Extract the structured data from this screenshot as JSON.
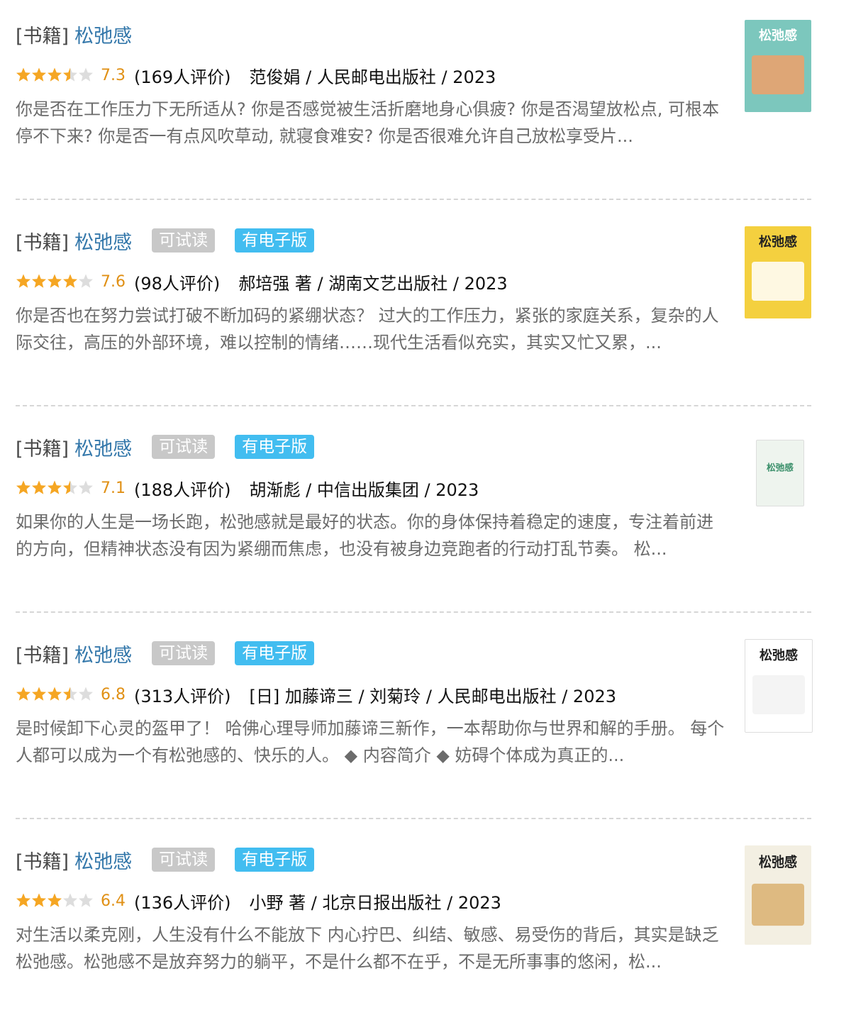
{
  "results": [
    {
      "category": "[书籍]",
      "title": "松弛感",
      "badges": [],
      "rating": 3.5,
      "score": "7.3",
      "votes": "(169人评价)",
      "pub": "范俊娟 / 人民邮电出版社 / 2023",
      "desc": "你是否在工作压力下无所适从? 你是否感觉被生活折磨地身心俱疲? 你是否渴望放松点, 可根本停不下来? 你是否一有点风吹草动, 就寝食难安? 你是否很难允许自己放松享受片...",
      "cover": {
        "text": "松弛感",
        "bg": "#7cc7bd"
      }
    },
    {
      "category": "[书籍]",
      "title": "松弛感",
      "badges": [
        "可试读",
        "有电子版"
      ],
      "rating": 4,
      "score": "7.6",
      "votes": "(98人评价)",
      "pub": "郝培强 著 / 湖南文艺出版社 / 2023",
      "desc": "你是否也在努力尝试打破不断加码的紧绷状态？ 过大的工作压力，紧张的家庭关系，复杂的人际交往，高压的外部环境，难以控制的情绪……现代生活看似充实，其实又忙又累，...",
      "cover": {
        "text": "松弛感",
        "bg": "#f4d03f"
      }
    },
    {
      "category": "[书籍]",
      "title": "松弛感",
      "badges": [
        "可试读",
        "有电子版"
      ],
      "rating": 3.5,
      "score": "7.1",
      "votes": "(188人评价)",
      "pub": "胡渐彪 / 中信出版集团 / 2023",
      "desc": "如果你的人生是一场长跑，松弛感就是最好的状态。你的身体保持着稳定的速度，专注着前进的方向，但精神状态没有因为紧绷而焦虑，也没有被身边竞跑者的行动打乱节奏。 松...",
      "cover": {
        "text": "松弛感",
        "bg": "#eef4ee"
      }
    },
    {
      "category": "[书籍]",
      "title": "松弛感",
      "badges": [
        "可试读",
        "有电子版"
      ],
      "rating": 3.5,
      "score": "6.8",
      "votes": "(313人评价)",
      "pub": "[日] 加藤谛三 / 刘菊玲 / 人民邮电出版社 / 2023",
      "desc": "是时候卸下心灵的盔甲了！ 哈佛心理导师加藤谛三新作，一本帮助你与世界和解的手册。 每个人都可以成为一个有松弛感的、快乐的人。 ◆ 内容简介 ◆ 妨碍个体成为真正的...",
      "cover": {
        "text": "松弛感",
        "bg": "#ffffff"
      }
    },
    {
      "category": "[书籍]",
      "title": "松弛感",
      "badges": [
        "可试读",
        "有电子版"
      ],
      "rating": 3,
      "score": "6.4",
      "votes": "(136人评价)",
      "pub": "小野 著 / 北京日报出版社 / 2023",
      "desc": "对生活以柔克刚，人生没有什么不能放下 内心拧巴、纠结、敏感、易受伤的背后，其实是缺乏松弛感。松弛感不是放弃努力的躺平，不是什么都不在乎，不是无所事事的悠闲，松...",
      "cover": {
        "text": "松弛感",
        "bg": "#f3efe2"
      }
    }
  ],
  "colors": {
    "link": "#3377aa",
    "star": "#f5a623",
    "star_empty": "#dddddd",
    "score": "#e09015",
    "badge_trial": "#c8c8c8",
    "badge_ebook": "#42bdf0"
  }
}
